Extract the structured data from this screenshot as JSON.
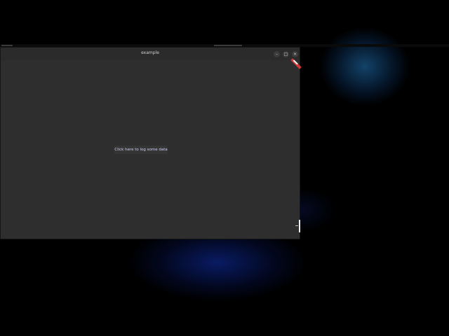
{
  "window": {
    "title": "example",
    "controls": {
      "minimize_icon": "minimize-icon",
      "maximize_icon": "maximize-icon",
      "close_icon": "close-icon"
    },
    "content": {
      "log_button_label": "Click here to log some data"
    }
  },
  "colors": {
    "window_bg": "#2e2e2e",
    "button_text": "#cdd0f2",
    "desktop_bg": "#000000"
  }
}
